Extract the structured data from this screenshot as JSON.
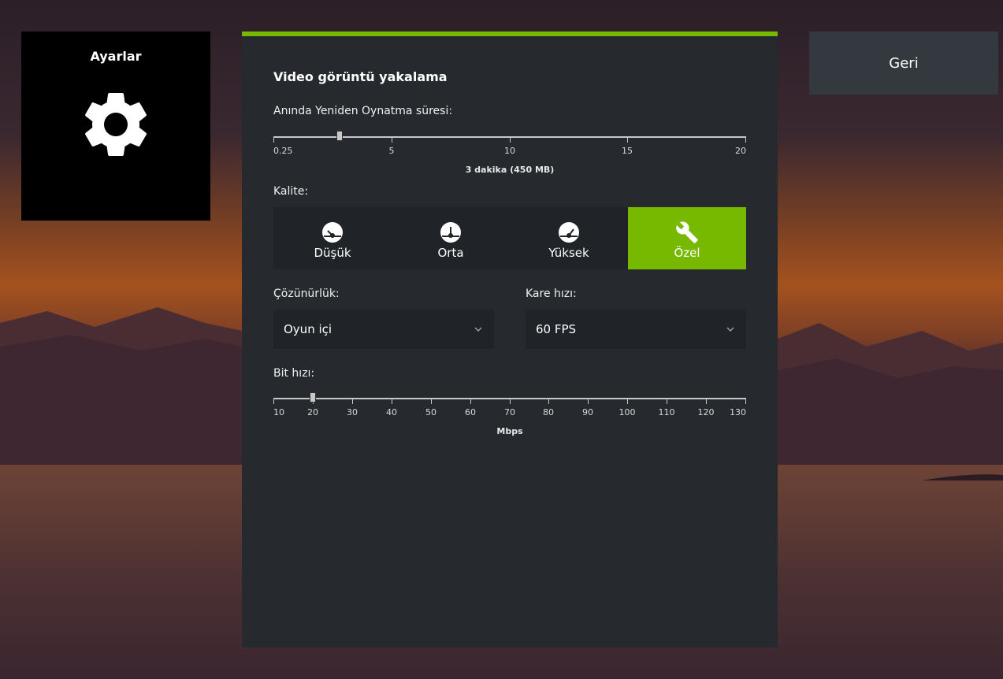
{
  "tile": {
    "title": "Ayarlar",
    "icon": "gear-icon"
  },
  "back_button": {
    "label": "Geri"
  },
  "panel": {
    "title": "Video görüntü yakalama",
    "accent_color": "#76b900",
    "replay": {
      "label": "Anında Yeniden Oynatma süresi:",
      "ticks": [
        "0.25",
        "5",
        "10",
        "15",
        "20"
      ],
      "min": 0.25,
      "max": 20,
      "value": 3,
      "value_label": "3 dakika (450 MB)"
    },
    "quality": {
      "label": "Kalite:",
      "options": [
        {
          "label": "Düşük",
          "icon": "gauge-low-icon",
          "active": false
        },
        {
          "label": "Orta",
          "icon": "gauge-medium-icon",
          "active": false
        },
        {
          "label": "Yüksek",
          "icon": "gauge-high-icon",
          "active": false
        },
        {
          "label": "Özel",
          "icon": "wrench-icon",
          "active": true
        }
      ]
    },
    "resolution": {
      "label": "Çözünürlük:",
      "value": "Oyun içi"
    },
    "framerate": {
      "label": "Kare hızı:",
      "value": "60 FPS"
    },
    "bitrate": {
      "label": "Bit hızı:",
      "ticks": [
        "10",
        "20",
        "30",
        "40",
        "50",
        "60",
        "70",
        "80",
        "90",
        "100",
        "110",
        "120",
        "130"
      ],
      "min": 10,
      "max": 130,
      "value": 20,
      "unit": "Mbps"
    }
  }
}
